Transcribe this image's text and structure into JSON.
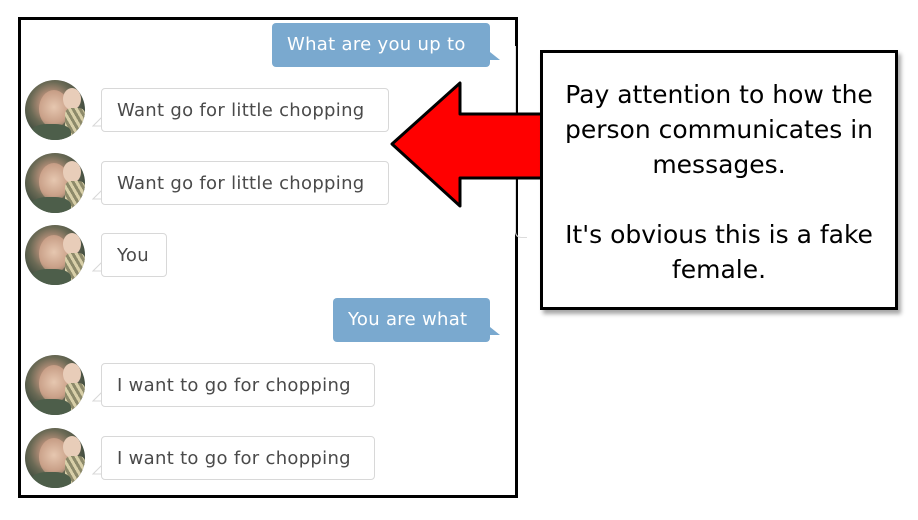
{
  "chat": {
    "messages": [
      {
        "direction": "sent",
        "text": "What are you up to"
      },
      {
        "direction": "received",
        "avatar": "contact-avatar",
        "text": "Want go for little chopping"
      },
      {
        "direction": "received",
        "avatar": "contact-avatar",
        "text": "Want go for little chopping"
      },
      {
        "direction": "received",
        "avatar": "contact-avatar",
        "text": "You"
      },
      {
        "direction": "sent",
        "text": "You are what"
      },
      {
        "direction": "received",
        "avatar": "contact-avatar",
        "text": "I want to go for chopping"
      },
      {
        "direction": "received",
        "avatar": "contact-avatar",
        "text": "I want to go for chopping"
      }
    ],
    "colors": {
      "sent_bubble": "#7aa9cf",
      "received_border": "#d8d8d8",
      "received_text": "#4a4a4a"
    }
  },
  "annotation": {
    "arrow_icon": "left-arrow-icon",
    "arrow_color": "#ff0000",
    "paragraph_1": "Pay attention to how the person communicates in messages.",
    "paragraph_2": "It's obvious this is a fake female."
  }
}
